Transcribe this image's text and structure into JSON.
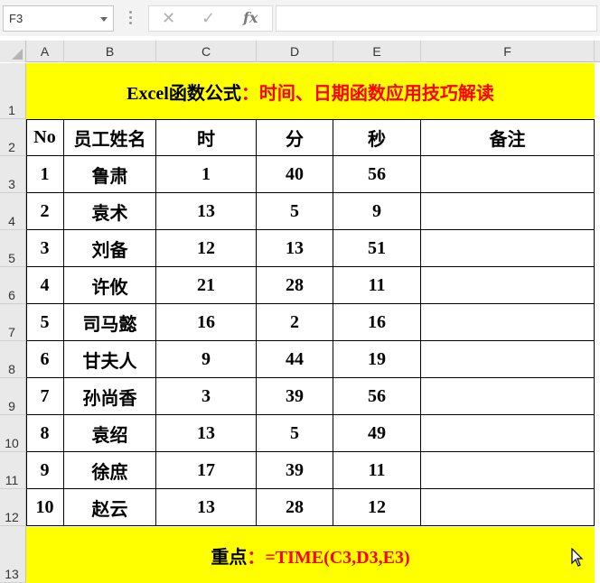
{
  "formula_bar": {
    "name_box": "F3",
    "cancel_icon": "✕",
    "enter_icon": "✓",
    "function_icon": "fx",
    "formula": ""
  },
  "columns": [
    "A",
    "B",
    "C",
    "D",
    "E",
    "F"
  ],
  "rows": [
    "1",
    "2",
    "3",
    "4",
    "5",
    "6",
    "7",
    "8",
    "9",
    "10",
    "11",
    "12",
    "13"
  ],
  "sheet": {
    "title_black": "Excel函数公式",
    "title_red": "：时间、日期函数应用技巧解读",
    "headers": [
      "No",
      "员工姓名",
      "时",
      "分",
      "秒",
      "备注"
    ],
    "records": [
      [
        "1",
        "鲁肃",
        "1",
        "40",
        "56",
        ""
      ],
      [
        "2",
        "袁术",
        "13",
        "5",
        "9",
        ""
      ],
      [
        "3",
        "刘备",
        "12",
        "13",
        "51",
        ""
      ],
      [
        "4",
        "许攸",
        "21",
        "28",
        "11",
        ""
      ],
      [
        "5",
        "司马懿",
        "16",
        "2",
        "16",
        ""
      ],
      [
        "6",
        "甘夫人",
        "9",
        "44",
        "19",
        ""
      ],
      [
        "7",
        "孙尚香",
        "3",
        "39",
        "56",
        ""
      ],
      [
        "8",
        "袁绍",
        "13",
        "5",
        "49",
        ""
      ],
      [
        "9",
        "徐庶",
        "17",
        "39",
        "11",
        ""
      ],
      [
        "10",
        "赵云",
        "13",
        "28",
        "12",
        ""
      ]
    ],
    "footer_black": "重点",
    "footer_red": "：=TIME(C3,D3,E3)"
  },
  "colors": {
    "banner_fill": "#ffff00",
    "accent_red": "#ff0000"
  }
}
